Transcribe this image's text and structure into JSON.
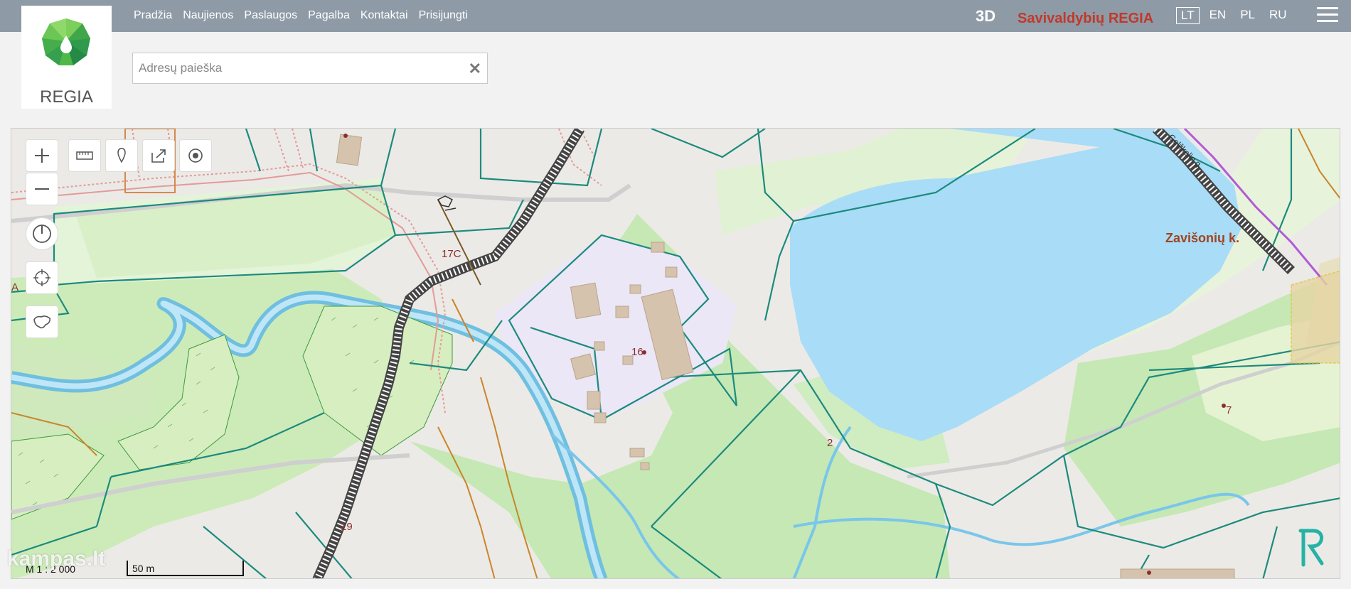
{
  "nav": {
    "items": [
      "Pradžia",
      "Naujienos",
      "Paslaugos",
      "Pagalba",
      "Kontaktai",
      "Prisijungti"
    ]
  },
  "header": {
    "mode_3d": "3D",
    "municipality": "Savivaldybių REGIA",
    "languages": [
      "LT",
      "EN",
      "PL",
      "RU"
    ],
    "active_language": "LT"
  },
  "logo": {
    "text": "REGIA"
  },
  "search": {
    "placeholder": "Adresų paieška",
    "value": "",
    "clear_label": "✕"
  },
  "map": {
    "labels": {
      "plot_17c": "17C",
      "plot_16": "16",
      "plot_2": "2",
      "plot_7": "7",
      "plot_19": "19",
      "edge_a": "A",
      "village": "Zavišonių k.",
      "road_diag": "Gelžkelio g."
    },
    "scale": {
      "ratio": "M 1 : 2 000",
      "bar": "50 m"
    },
    "watermark": "kampas.lt",
    "colors": {
      "water": "#a9dcf7",
      "forest": "#bfe7b4",
      "forest_light": "#d9f0c9",
      "parcel_line": "#1c8a7d",
      "railway": "#555555",
      "built": "#eae6f6",
      "building": "#d6c3ad"
    }
  }
}
